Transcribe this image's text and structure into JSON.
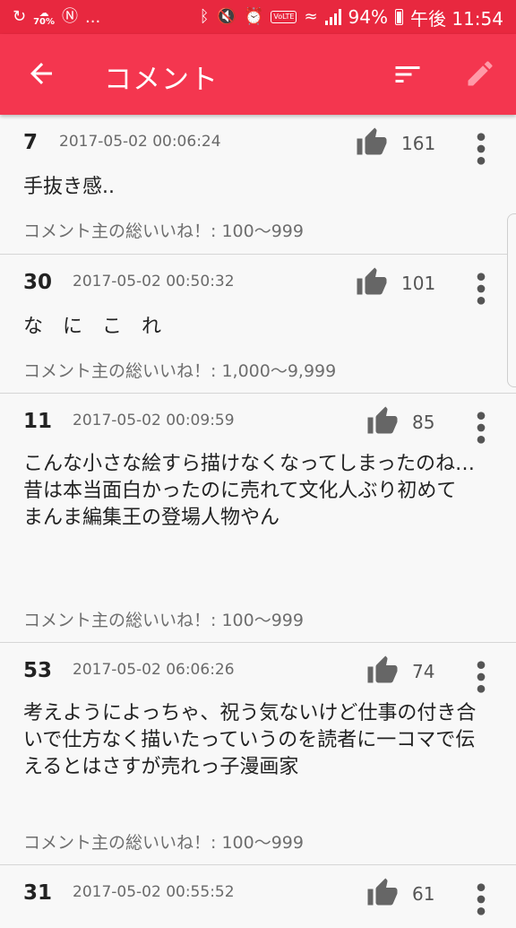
{
  "status_bar": {
    "battery_label": "70%",
    "battery_percent": "94%",
    "time": "午後 11:54",
    "dots": "..."
  },
  "app_bar": {
    "title": "コメント"
  },
  "comments": [
    {
      "number": "7",
      "date": "2017-05-02 00:06:24",
      "likes": "161",
      "text": "手抜き感..",
      "total_likes": "コメント主の総いいね！:   100〜999"
    },
    {
      "number": "30",
      "date": "2017-05-02 00:50:32",
      "likes": "101",
      "text": "な　に　こ　れ",
      "total_likes": "コメント主の総いいね！:   1,000〜9,999"
    },
    {
      "number": "11",
      "date": "2017-05-02 00:09:59",
      "likes": "85",
      "text": "こんな小さな絵すら描けなくなってしまったのね…\n昔は本当面白かったのに売れて文化人ぶり初めて\nまんま編集王の登場人物やん",
      "total_likes": "コメント主の総いいね！:   100〜999"
    },
    {
      "number": "53",
      "date": "2017-05-02 06:06:26",
      "likes": "74",
      "text": "考えようによっちゃ、祝う気ないけど仕事の付き合いで仕方なく描いたっていうのを読者に一コマで伝えるとはさすが売れっ子漫画家",
      "total_likes": "コメント主の総いいね！:   100〜999"
    },
    {
      "number": "31",
      "date": "2017-05-02 00:55:52",
      "likes": "61",
      "text": "",
      "total_likes": ""
    }
  ]
}
